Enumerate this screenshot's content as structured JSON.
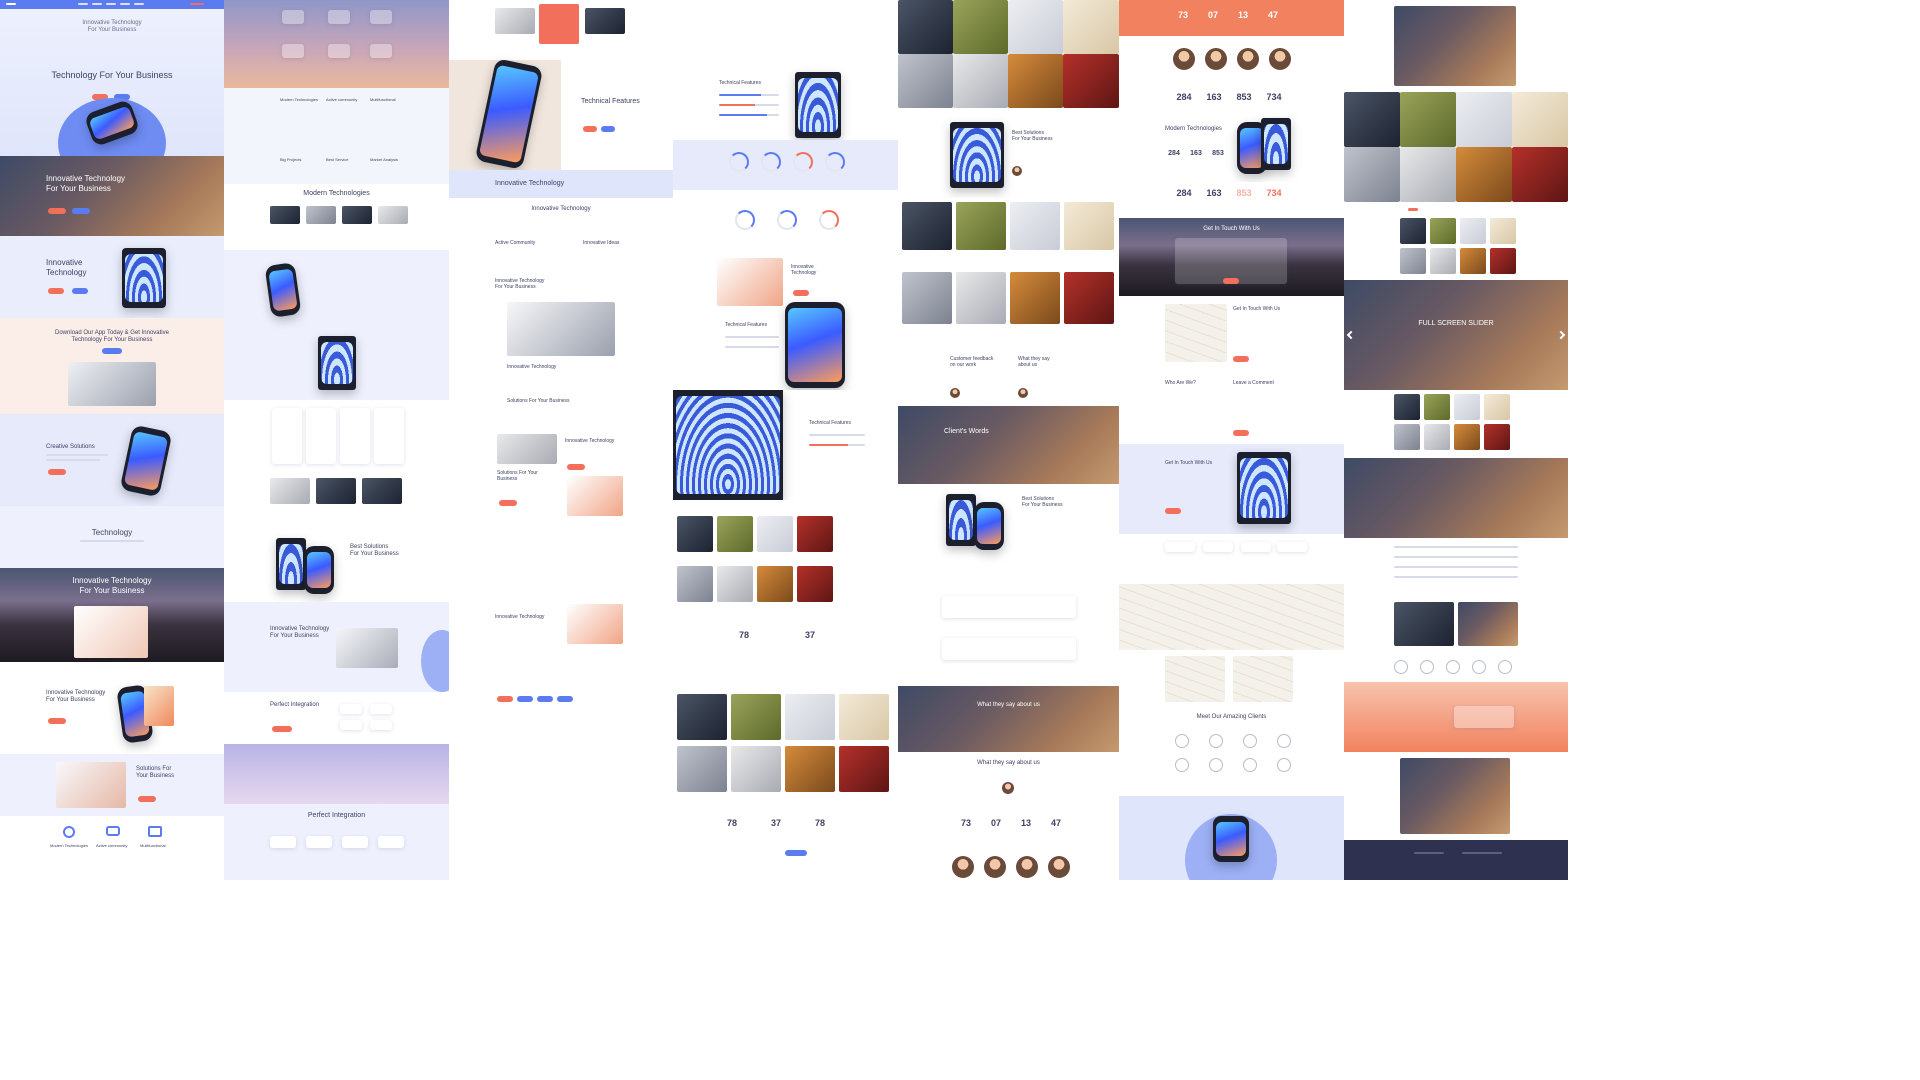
{
  "columns": [
    {
      "texts": {
        "hero_title": "Innovative Technology\nFor Your Business",
        "hero_sub": "Technology For Your Business",
        "laptop_title": "Innovative Technology\nFor Your Business",
        "tech_title": "Innovative\nTechnology",
        "download": "Download Our App Today & Get Innovative\nTechnology For Your Business",
        "creative": "Creative Solutions",
        "technology": "Technology",
        "mountain_title": "Innovative Technology\nFor Your Business",
        "it_title": "Innovative Technology\nFor Your Business",
        "solutions": "Solutions For\nYour Business",
        "icon_labels": [
          "Modern Technologies",
          "Active community",
          "Multifunctional"
        ]
      }
    },
    {
      "texts": {
        "modern": "Modern Technologies",
        "best": "Best Solutions\nFor Your Business",
        "it_title": "Innovative Technology\nFor Your Business",
        "perfect": "Perfect Integration",
        "perfect2": "Perfect Integration",
        "feature_labels": [
          "Modern Technologies",
          "Active community",
          "Multifunctional",
          "Big Projects",
          "Best Service",
          "Market Analysis"
        ]
      }
    },
    {
      "texts": {
        "tech_features": "Technical Features",
        "band": "Innovative Technology",
        "it_heading": "Innovative Technology",
        "active": "Active Community",
        "ideas": "Innovative Ideas",
        "it_business": "Innovative Technology\nFor Your Business",
        "it_small": "Innovative Technology",
        "solutions": "Solutions For Your Business",
        "it_right": "Innovative Technology",
        "sol_left": "Solutions For Your\nBusiness",
        "it_bottom": "Innovative Technology"
      }
    },
    {
      "texts": {
        "tech_features": "Technical Features",
        "it": "Innovative\nTechnology",
        "tech_features2": "Technical Features",
        "tech_features3": "Technical Features",
        "n1": "78",
        "n2": "37",
        "n3": "78",
        "n4": "37",
        "n5": "78"
      }
    },
    {
      "texts": {
        "best": "Best Solutions\nFor Your Business",
        "feedback": "Customer feedback\non our work",
        "what": "What they say\nabout us",
        "clients": "Client's Words",
        "best2": "Best Solutions\nFor Your Business",
        "what2": "What they say about us",
        "what3": "What they say about us",
        "stats": [
          "73",
          "07",
          "13",
          "47"
        ]
      }
    },
    {
      "texts": {
        "stats_top": [
          "73",
          "07",
          "13",
          "47"
        ],
        "stats_mid": [
          "284",
          "163",
          "853",
          "734"
        ],
        "modern": "Modern Technologies",
        "stats_a": [
          "284",
          "163",
          "853"
        ],
        "stats_b": [
          "284",
          "163",
          "853",
          "734"
        ],
        "touch": "Get In Touch With Us",
        "touch2": "Get In Touch With Us",
        "who": "Who Are We?",
        "comment": "Leave a Comment",
        "touch3": "Get In Touch With Us",
        "clients": "Meet Our Amazing Clients"
      }
    },
    {
      "texts": {
        "slider": "FULL SCREEN SLIDER"
      }
    }
  ]
}
